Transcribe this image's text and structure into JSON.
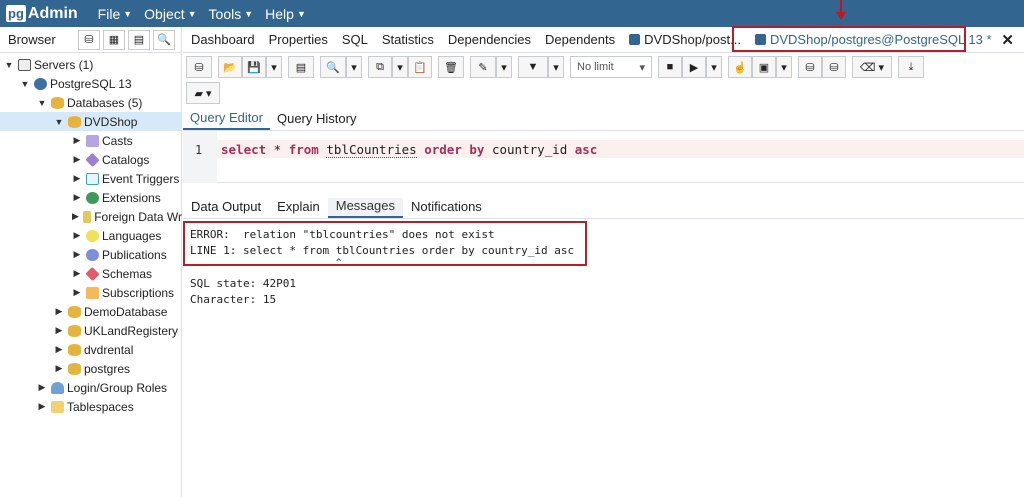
{
  "navbar": {
    "logo_pg": "pg",
    "logo_admin": "Admin",
    "menu": [
      {
        "label": "File"
      },
      {
        "label": "Object"
      },
      {
        "label": "Tools"
      },
      {
        "label": "Help"
      }
    ]
  },
  "browser": {
    "title": "Browser",
    "tree": [
      {
        "label": "Servers (1)",
        "icon": "server-icon"
      },
      {
        "label": "PostgreSQL 13",
        "icon": "postgres-icon"
      },
      {
        "label": "Databases (5)",
        "icon": "database-icon"
      },
      {
        "label": "DVDShop",
        "icon": "database-icon"
      },
      {
        "label": "Casts",
        "icon": "cast-icon"
      },
      {
        "label": "Catalogs",
        "icon": "catalog-icon"
      },
      {
        "label": "Event Triggers",
        "icon": "event-trigger-icon"
      },
      {
        "label": "Extensions",
        "icon": "extension-icon"
      },
      {
        "label": "Foreign Data Wr",
        "icon": "foreign-data-wrapper-icon"
      },
      {
        "label": "Languages",
        "icon": "language-icon"
      },
      {
        "label": "Publications",
        "icon": "publication-icon"
      },
      {
        "label": "Schemas",
        "icon": "schema-icon"
      },
      {
        "label": "Subscriptions",
        "icon": "subscription-icon"
      },
      {
        "label": "DemoDatabase",
        "icon": "database-icon"
      },
      {
        "label": "UKLandRegistery",
        "icon": "database-icon"
      },
      {
        "label": "dvdrental",
        "icon": "database-icon"
      },
      {
        "label": "postgres",
        "icon": "database-icon"
      },
      {
        "label": "Login/Group Roles",
        "icon": "login-role-icon"
      },
      {
        "label": "Tablespaces",
        "icon": "tablespace-icon"
      }
    ]
  },
  "main": {
    "tabs": [
      {
        "label": "Dashboard"
      },
      {
        "label": "Properties"
      },
      {
        "label": "SQL"
      },
      {
        "label": "Statistics"
      },
      {
        "label": "Dependencies"
      },
      {
        "label": "Dependents"
      },
      {
        "label": "DVDShop/post..."
      },
      {
        "label": "DVDShop/postgres@PostgreSQL 13 *"
      }
    ],
    "toolbar": {
      "limit_label": "No limit"
    },
    "editor_tabs": [
      {
        "label": "Query Editor"
      },
      {
        "label": "Query History"
      }
    ],
    "editor": {
      "line_number": "1",
      "kw_select": "select",
      "star": " * ",
      "kw_from": "from",
      "table": "tblCountries",
      "kw_order_by": "order by",
      "rest": " country_id ",
      "kw_asc": "asc"
    },
    "output_tabs": [
      {
        "label": "Data Output"
      },
      {
        "label": "Explain"
      },
      {
        "label": "Messages"
      },
      {
        "label": "Notifications"
      }
    ],
    "messages": {
      "error": "ERROR:  relation \"tblcountries\" does not exist",
      "line": "LINE 1: select * from tblCountries order by country_id asc",
      "caret": "^",
      "sql_state": "SQL state: 42P01",
      "character": "Character: 15"
    }
  },
  "colors": {
    "navbar": "#326690",
    "highlight": "#b22028",
    "selected_row": "#d6e9f8"
  }
}
